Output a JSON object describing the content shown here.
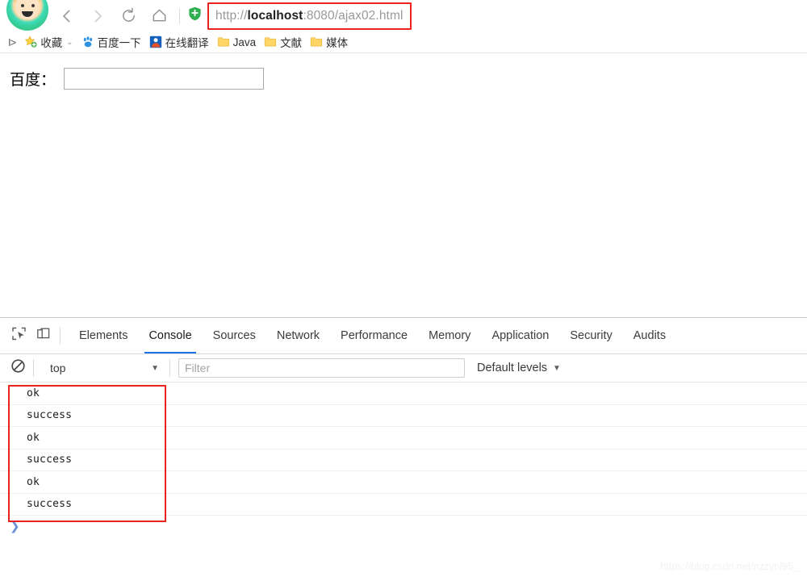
{
  "browser": {
    "avatar_icon": "user-avatar",
    "nav": {
      "back_icon": "back-arrow-icon",
      "forward_icon": "forward-arrow-icon",
      "reload_icon": "reload-icon",
      "home_icon": "home-icon"
    },
    "omnibox": {
      "security_icon": "green-shield-icon",
      "url_scheme": "http://",
      "url_host": "localhost",
      "url_path": ":8080/ajax02.html",
      "url_full": "http://localhost:8080/ajax02.html",
      "annotation_color": "#e8231f"
    },
    "bookmarks": {
      "overflow_label": "I>",
      "items": [
        {
          "label": "收藏",
          "icon": "star-add-icon",
          "has_chevron": true,
          "chevron": "⌄"
        },
        {
          "label": "百度一下",
          "icon": "baidu-paw-icon",
          "has_chevron": false,
          "chevron": ""
        },
        {
          "label": "在线翻译",
          "icon": "translate-icon",
          "has_chevron": false,
          "chevron": ""
        },
        {
          "label": "Java",
          "icon": "folder-icon",
          "has_chevron": false,
          "chevron": ""
        },
        {
          "label": "文献",
          "icon": "folder-icon",
          "has_chevron": false,
          "chevron": ""
        },
        {
          "label": "媒体",
          "icon": "folder-icon",
          "has_chevron": false,
          "chevron": ""
        }
      ]
    }
  },
  "page": {
    "label": "百度：",
    "input_value": "",
    "input_placeholder": ""
  },
  "devtools": {
    "inspect_icon": "inspect-element-icon",
    "device_icon": "device-toolbar-icon",
    "tabs": [
      {
        "label": "Elements",
        "active": false
      },
      {
        "label": "Console",
        "active": true
      },
      {
        "label": "Sources",
        "active": false
      },
      {
        "label": "Network",
        "active": false
      },
      {
        "label": "Performance",
        "active": false
      },
      {
        "label": "Memory",
        "active": false
      },
      {
        "label": "Application",
        "active": false
      },
      {
        "label": "Security",
        "active": false
      },
      {
        "label": "Audits",
        "active": false
      }
    ],
    "active_tab_underline_color": "#1a73e8",
    "console_toolbar": {
      "clear_icon": "clear-console-icon",
      "context_value": "top",
      "context_caret": "▼",
      "filter_placeholder": "Filter",
      "filter_value": "",
      "levels_label": "Default levels",
      "levels_caret": "▼"
    },
    "console_messages": [
      "ok",
      "success",
      "ok",
      "success",
      "ok",
      "success"
    ],
    "console_prompt_symbol": "❯",
    "annotation_color": "#e8231f"
  },
  "watermark": "https://blog.csdn.net/nzzynl95_"
}
